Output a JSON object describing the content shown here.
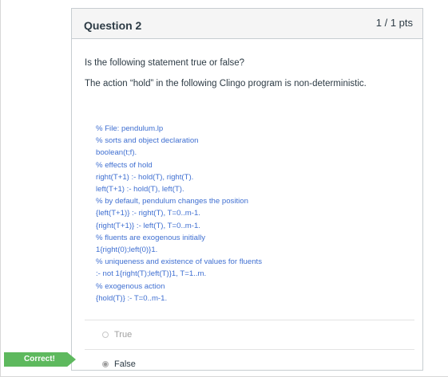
{
  "question": {
    "title": "Question 2",
    "points": "1 / 1 pts",
    "prompt": "Is the following statement true or false?",
    "statement": "The action “hold” in the following Clingo program is non-deterministic.",
    "code_lines": [
      "% File: pendulum.lp",
      "% sorts and object declaration",
      "boolean(t;f).",
      "% effects of hold",
      "right(T+1) :- hold(T), right(T).",
      "left(T+1) :- hold(T), left(T).",
      "% by default, pendulum changes the position",
      "{left(T+1)} :- right(T), T=0..m-1.",
      "{right(T+1)} :- left(T), T=0..m-1.",
      "% fluents are exogenous initially",
      "1{right(0);left(0)}1.",
      "% uniqueness and existence of values for fluents",
      ":- not 1{right(T);left(T)}1, T=1..m.",
      "% exogenous action",
      "{hold(T)} :- T=0..m-1."
    ],
    "answers": [
      {
        "label": "True",
        "selected": false
      },
      {
        "label": "False",
        "selected": true
      }
    ],
    "feedback_badge": "Correct!",
    "colors": {
      "code": "#3f6fd1",
      "badge": "#5eb95e",
      "header_bg": "#f5f5f5",
      "text": "#2d3b45"
    }
  }
}
